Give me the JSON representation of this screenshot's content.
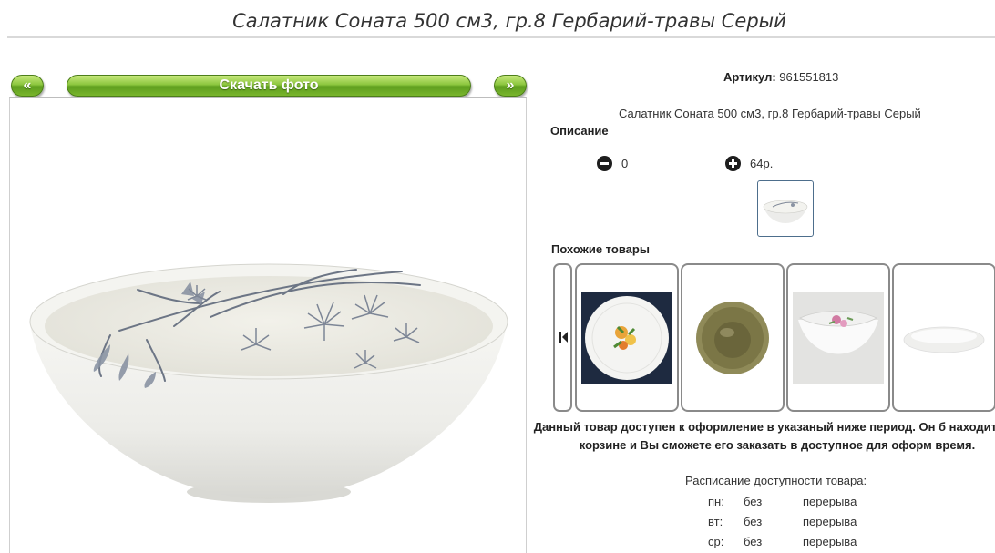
{
  "page": {
    "title": "Салатник Соната 500 см3, гр.8 Гербарий-травы Серый"
  },
  "photo_nav": {
    "prev_label": "«",
    "download_label": "Скачать фото",
    "next_label": "»"
  },
  "product": {
    "article_label": "Артикул:",
    "article_value": "961551813",
    "name_line": "Салатник Соната 500 см3, гр.8 Гербарий-травы Серый",
    "description_label": "Описание",
    "quantity": "0",
    "price": "64р."
  },
  "similar": {
    "label": "Похожие товары",
    "items": [
      {
        "icon": "plate-with-flowers"
      },
      {
        "icon": "smoked-glass-plate"
      },
      {
        "icon": "square-bowl-with-rose"
      },
      {
        "icon": "white-deep-plate"
      }
    ]
  },
  "availability": {
    "notice": "Данный товар доступен к оформление в указаный ниже период. Он б находится в корзине и Вы сможете его заказать в доступное для оформ время.",
    "schedule_title": "Расписание доступности товара:",
    "rows": [
      {
        "day": "пн:",
        "from": "без",
        "to": "перерыва"
      },
      {
        "day": "вт:",
        "from": "без",
        "to": "перерыва"
      },
      {
        "day": "ср:",
        "from": "без",
        "to": "перерыва"
      }
    ]
  },
  "colors": {
    "button_green": "#8cc63e",
    "button_green_dark": "#5e9e1e",
    "card_border": "#8a8a8a",
    "thumb_border": "#4d6e8c"
  }
}
